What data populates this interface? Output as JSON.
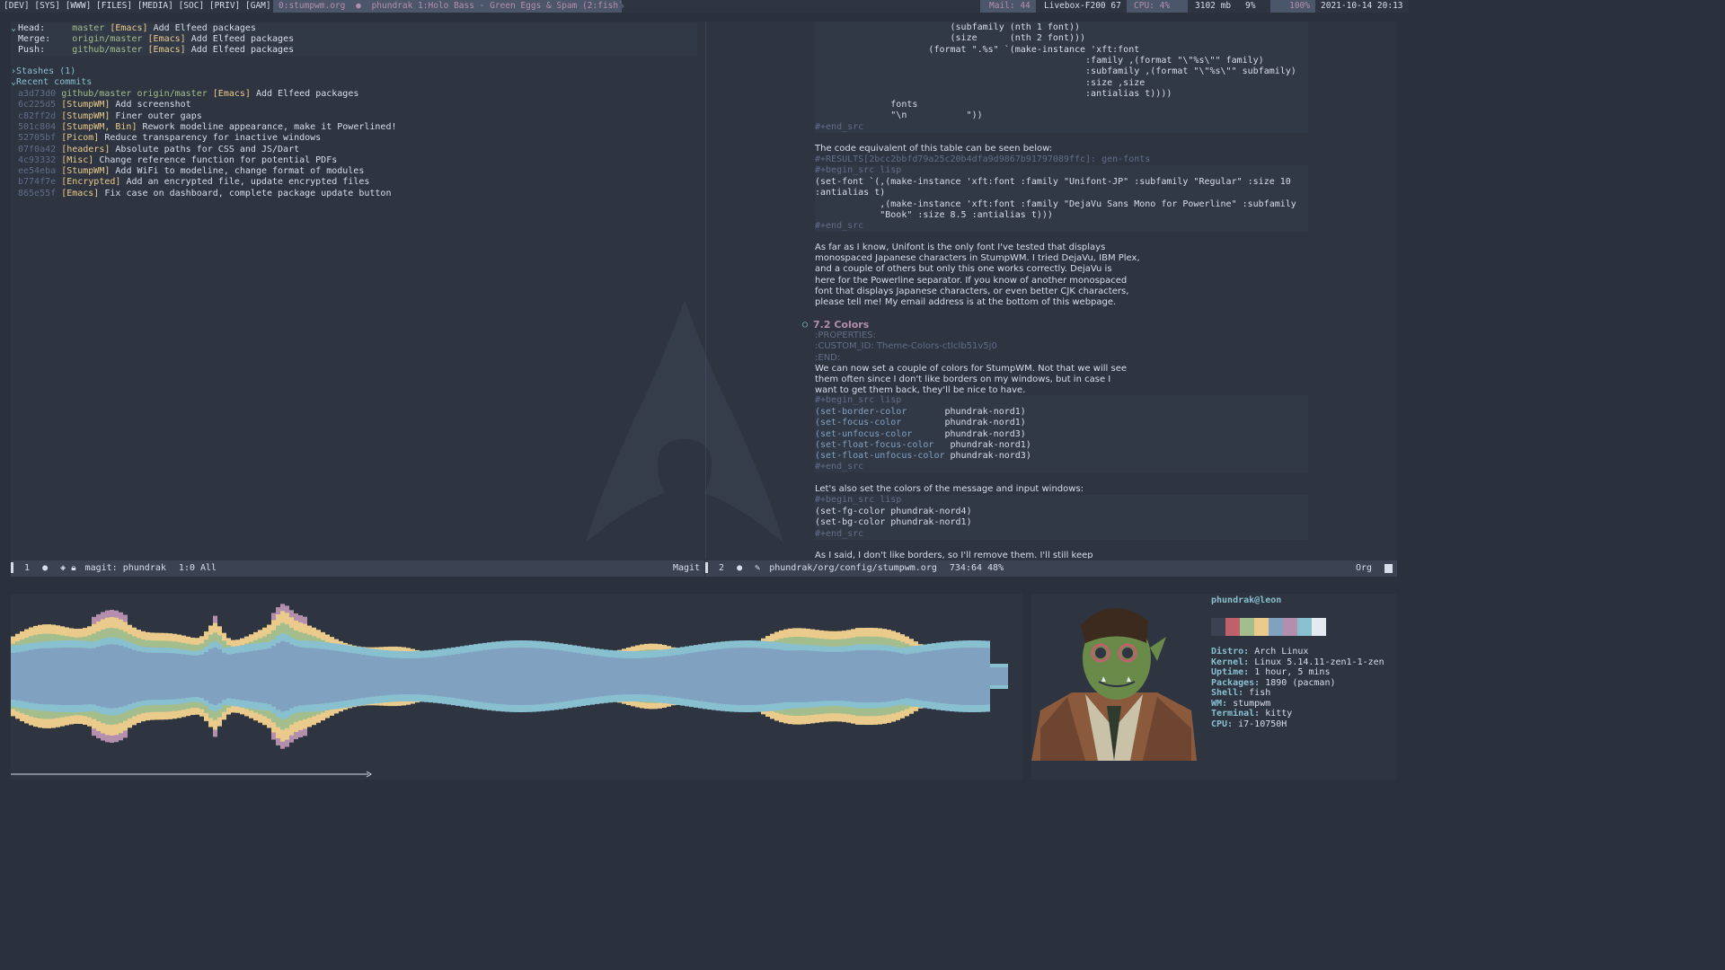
{
  "topbar": {
    "groups": [
      "[DEV]",
      "[SYS]",
      "[WWW]",
      "[FILES]",
      "[MEDIA]",
      "[SOC]",
      "[PRIV]",
      "[GAM]"
    ],
    "window0": "0:stumpwm.org",
    "bullet": "●",
    "window1": "phundrak 1:Holo Bass - Green Eggs & Spam (2:fish)",
    "mail": "Mail: 44",
    "wifi": "Livebox-F200 67",
    "cpu": "CPU: 4%",
    "mem": "3102 mb",
    "mem_pct": "9%",
    "battery": "100%",
    "datetime": "2021-10-14 20:13"
  },
  "magit": {
    "head_label": "Head:",
    "head_branch": "master",
    "head_tag": "[Emacs]",
    "head_msg": "Add Elfeed packages",
    "merge_label": "Merge:",
    "merge_branch": "origin/master",
    "merge_tag": "[Emacs]",
    "merge_msg": "Add Elfeed packages",
    "push_label": "Push:",
    "push_branch": "github/master",
    "push_tag": "[Emacs]",
    "push_msg": "Add Elfeed packages",
    "stashes": "Stashes (1)",
    "recent": "Recent commits",
    "commits": [
      {
        "hash": "a3d73d0",
        "refs": "github/master origin/master",
        "tag": "[Emacs]",
        "msg": "Add Elfeed packages"
      },
      {
        "hash": "6c225d5",
        "refs": "",
        "tag": "[StumpWM]",
        "msg": "Add screenshot"
      },
      {
        "hash": "c82ff2d",
        "refs": "",
        "tag": "[StumpWM]",
        "msg": "Finer outer gaps"
      },
      {
        "hash": "501c804",
        "refs": "",
        "tag": "[StumpWM, Bin]",
        "msg": "Rework modeline appearance, make it Powerlined!"
      },
      {
        "hash": "52705bf",
        "refs": "",
        "tag": "[Picom]",
        "msg": "Reduce transparency for inactive windows"
      },
      {
        "hash": "07f0a42",
        "refs": "",
        "tag": "[headers]",
        "msg": "Absolute paths for CSS and JS/Dart"
      },
      {
        "hash": "4c93332",
        "refs": "",
        "tag": "[Misc]",
        "msg": "Change reference function for potential PDFs"
      },
      {
        "hash": "ee54eba",
        "refs": "",
        "tag": "[StumpWM]",
        "msg": "Add WiFi to modeline, change format of modules"
      },
      {
        "hash": "b774f7e",
        "refs": "",
        "tag": "[Encrypted]",
        "msg": "Add an encrypted file, update encrypted files"
      },
      {
        "hash": "865e55f",
        "refs": "",
        "tag": "[Emacs]",
        "msg": "Fix case on dashboard, complete package update button"
      }
    ]
  },
  "org": {
    "code1": [
      "                         (subfamily (nth 1 font))",
      "                         (size      (nth 2 font)))",
      "                     (format \".%s\" `(make-instance 'xft:font",
      "                                                  :family ,(format \"\\\"%s\\\"\" family)",
      "                                                  :subfamily ,(format \"\\\"%s\\\"\" subfamily)",
      "                                                  :size ,size",
      "                                                  :antialias t))))",
      "              fonts",
      "              \"\\n           \"))"
    ],
    "end_src": "#+end_src",
    "begin_src": "#+begin_src lisp",
    "para1": "The code equivalent of this table can be seen below:",
    "results": "#+RESULTS[2bcc2bbfd79a25c20b4dfa9d9867b91797089ffc]: gen-fonts",
    "code2": [
      "(set-font `(,(make-instance 'xft:font :family \"Unifont-JP\" :subfamily \"Regular\" :size 10",
      ":antialias t)",
      "            ,(make-instance 'xft:font :family \"DejaVu Sans Mono for Powerline\" :subfamily",
      "            \"Book\" :size 8.5 :antialias t)))"
    ],
    "para2": [
      "As far as I know, Unifont is the only font I've tested that displays",
      "monospaced Japanese characters in StumpWM. I tried DejaVu, IBM Plex,",
      "and a couple of others but only this one works correctly. DejaVu is",
      "here for the Powerline separator. If you know of another monospaced",
      "font that displays Japanese characters, or even better CJK characters,",
      "please tell me! My email address is at the bottom of this webpage."
    ],
    "heading_bullet": "○",
    "heading": "7.2 Colors",
    "props": [
      ":PROPERTIES:",
      ":CUSTOM_ID: Theme-Colors-ctlclb51v5j0",
      ":END:"
    ],
    "para3": [
      "We can now set a couple of colors for StumpWM. Not that we will see",
      "them often since I don't like borders on my windows, but in case I",
      "want to get them back, they'll be nice to have."
    ],
    "code3": [
      {
        "fn": "(set-border-color",
        "pad": "       ",
        "val": "phundrak-nord1)"
      },
      {
        "fn": "(set-focus-color",
        "pad": "        ",
        "val": "phundrak-nord1)"
      },
      {
        "fn": "(set-unfocus-color",
        "pad": "      ",
        "val": "phundrak-nord3)"
      },
      {
        "fn": "(set-float-focus-color",
        "pad": "   ",
        "val": "phundrak-nord1)"
      },
      {
        "fn": "(set-float-unfocus-color",
        "pad": " ",
        "val": "phundrak-nord3)"
      }
    ],
    "para4": "Let's also set the colors of the message and input windows:",
    "code4": [
      "(set-fg-color phundrak-nord4)",
      "(set-bg-color phundrak-nord1)"
    ],
    "para5": "As I said, I don't like borders, so I'll remove them. I'll still keep"
  },
  "modeline_left": {
    "num": "1",
    "buffer": "magit: phundrak",
    "pos": "1:0 All",
    "mode": "Magit"
  },
  "modeline_right": {
    "num": "2",
    "path": "phundrak/org/config/stumpwm.org",
    "pos": "734:64 48%",
    "mode": "Org"
  },
  "fetch": {
    "userhost": "phundrak@leon",
    "distro_k": "Distro:",
    "distro_v": "Arch Linux",
    "kernel_k": "Kernel:",
    "kernel_v": "Linux 5.14.11-zen1-1-zen",
    "uptime_k": "Uptime:",
    "uptime_v": "1 hour, 5 mins",
    "packages_k": "Packages:",
    "packages_v": "1890 (pacman)",
    "shell_k": "Shell:",
    "shell_v": "fish",
    "wm_k": "WM:",
    "wm_v": "stumpwm",
    "terminal_k": "Terminal:",
    "terminal_v": "kitty",
    "cpu_k": "CPU:",
    "cpu_v": "i7-10750H",
    "palette": [
      "#3b4252",
      "#bf616a",
      "#a3be8c",
      "#ebcb8b",
      "#81a1c1",
      "#b48ead",
      "#88c0d0",
      "#e5e9f0"
    ]
  },
  "visualizer": {
    "colors": {
      "core": "#81a1c1",
      "band": "#88c0d0",
      "mid": "#a3be8c",
      "outer": "#ebcb8b",
      "peak": "#b48ead"
    }
  },
  "colors": {
    "bg": "#2e3440",
    "accent": "#88c0d0",
    "purple": "#b48ead",
    "green": "#a3be8c",
    "yellow": "#ebcb8b"
  }
}
